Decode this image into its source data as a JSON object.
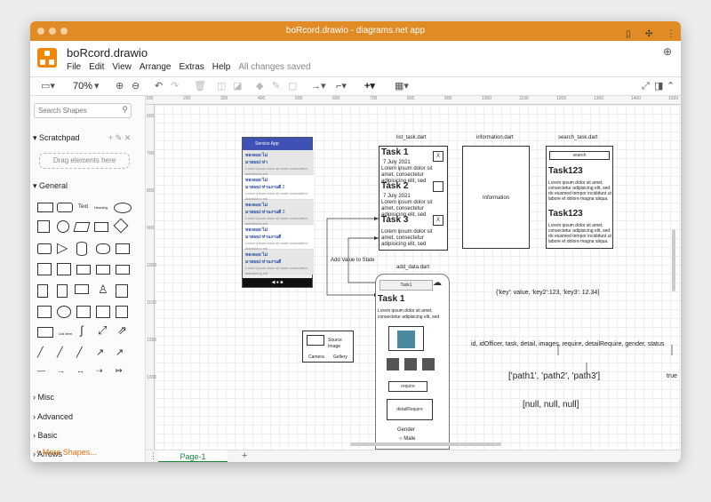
{
  "window": {
    "title": "boRcord.drawio - diagrams.net app"
  },
  "app": {
    "file_name": "boRcord.drawio",
    "status": "All changes saved",
    "menu": [
      "File",
      "Edit",
      "View",
      "Arrange",
      "Extras",
      "Help"
    ]
  },
  "toolbar": {
    "zoom": "70%"
  },
  "sidebar": {
    "search_placeholder": "Search Shapes",
    "scratchpad": "Scratchpad",
    "drop_hint": "Drag elements here",
    "general": "General",
    "sections": [
      "Misc",
      "Advanced",
      "Basic",
      "Arrows"
    ],
    "more_shapes": "+ More Shapes...",
    "shape_text": "Text",
    "shape_heading": "Heading",
    "shape_list": "List Item"
  },
  "ruler": {
    "h": [
      "100",
      "200",
      "300",
      "400",
      "500",
      "600",
      "700",
      "800",
      "900",
      "1000",
      "1100",
      "1200",
      "1300",
      "1400",
      "1500"
    ],
    "v": [
      "600",
      "700",
      "800",
      "900",
      "1000",
      "1100",
      "1200",
      "1300"
    ]
  },
  "diagram": {
    "list_task": "list_task.dart",
    "information": "information.dart",
    "search_task": "search_task.dart",
    "add_data": "add_data.dart",
    "tasks": [
      {
        "title": "Task 1",
        "date": "7 July 2021",
        "body": "Lorem ipsum dolor sit amet, consectetur adipisicing elit, sed"
      },
      {
        "title": "Task 2",
        "date": "7 July 2021",
        "body": "Lorem ipsum dolor sit amet, consectetur adipisicing elit, sed"
      },
      {
        "title": "Task 3",
        "date": "",
        "body": "Lorem ipsum dolor sit amet, consectetur adipisicing elit, sed"
      }
    ],
    "x": "X",
    "information_label": "Information",
    "search_btn": "search",
    "search_results": [
      {
        "title": "Task123",
        "body": "Lorem ipsum dolor sit amet, consectetur adipisicing elit, sed do eiusmod tempor incididunt ut labore et dolore magna aliqua."
      },
      {
        "title": "Task123",
        "body": "Lorem ipsum dolor sit amet, consectetur adipisicing elit, sed do eiusmod tempor incididunt ut labore et dolore magna aliqua."
      }
    ],
    "add_value": "Add Value to State",
    "phone": {
      "app_title": "Service App",
      "rows": [
        {
          "title": "หลงลอย ไม่",
          "sub": "มาสอยง่ ท่า",
          "text": "Lorem ipsum dolor sit amet consectetur adipisicing elit"
        },
        {
          "title": "หลงลอย ไม่",
          "sub": "มาสอยง่ ท่านงานดี",
          "num": "2",
          "text": "Lorem ipsum dolor sit amet consectetur adipisicing elit"
        },
        {
          "title": "หลงลอย ไม่",
          "sub": "มาสอยง่ ท่านงานดี",
          "num": "3",
          "text": "Lorem ipsum dolor sit amet consectetur adipisicing elit"
        },
        {
          "title": "หลงลอย ไม่",
          "sub": "มาสอยง่ ท่านงานดี",
          "text": "Lorem ipsum dolor sit amet consectetur adipisicing elit"
        },
        {
          "title": "หลงลอย ไม่",
          "sub": "มาสอยง่ ท่านงานดี",
          "text": "Lorem ipsum dolor sit amet consectetur adipisicing elit"
        }
      ]
    },
    "form": {
      "header": "Task1",
      "title": "Task 1",
      "body": "Lorem ipsum dolor sit amet, consectetur adipisicing elit, sed",
      "require": "require",
      "detail_require": "detailRequire",
      "gender": "Gender",
      "male": "Male"
    },
    "source_image": "Source Image",
    "camera": "Camera",
    "gallery": "Gellery",
    "json_note": "{'key': value, 'key2':123, 'key3': 12.34}",
    "fields_note": "id,  idOfficer, task, detail, images, require, detailRequire, gender, status",
    "paths_note": "['path1', 'path2', 'path3']",
    "true_note": "true",
    "null_note": "[null, null, null]"
  },
  "page_tab": "Page-1"
}
